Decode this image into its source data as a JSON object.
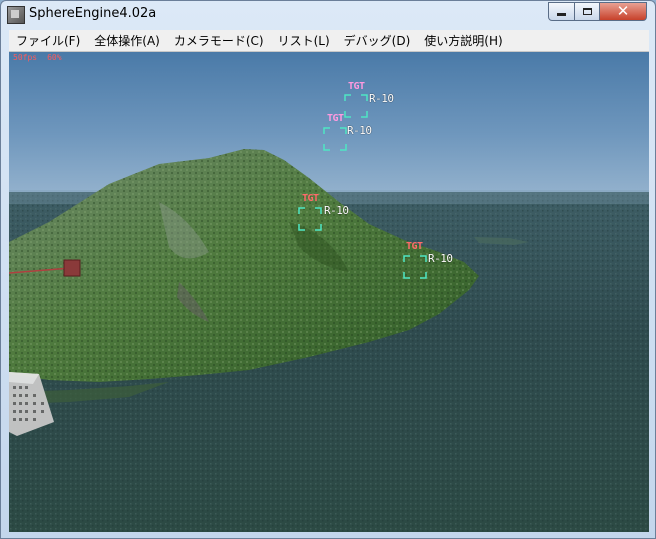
{
  "window": {
    "title": "SphereEngine4.02a"
  },
  "menu": [
    "ファイル(F)",
    "全体操作(A)",
    "カメラモード(C)",
    "リスト(L)",
    "デバッグ(D)",
    "使い方説明(H)"
  ],
  "hud": {
    "fps": "50fps",
    "load": "60%",
    "targets": [
      {
        "tag": "TGT",
        "range": "R-10",
        "tag_color": "#ff9ae0"
      },
      {
        "tag": "TGT",
        "range": "R-10",
        "tag_color": "#ff9ae0"
      },
      {
        "tag": "TGT",
        "range": "R-10",
        "tag_color": "#ff6a6a"
      },
      {
        "tag": "TGT",
        "range": "R-10",
        "tag_color": "#ff6a6a"
      }
    ],
    "bracket_color": "#4fe6c4"
  }
}
